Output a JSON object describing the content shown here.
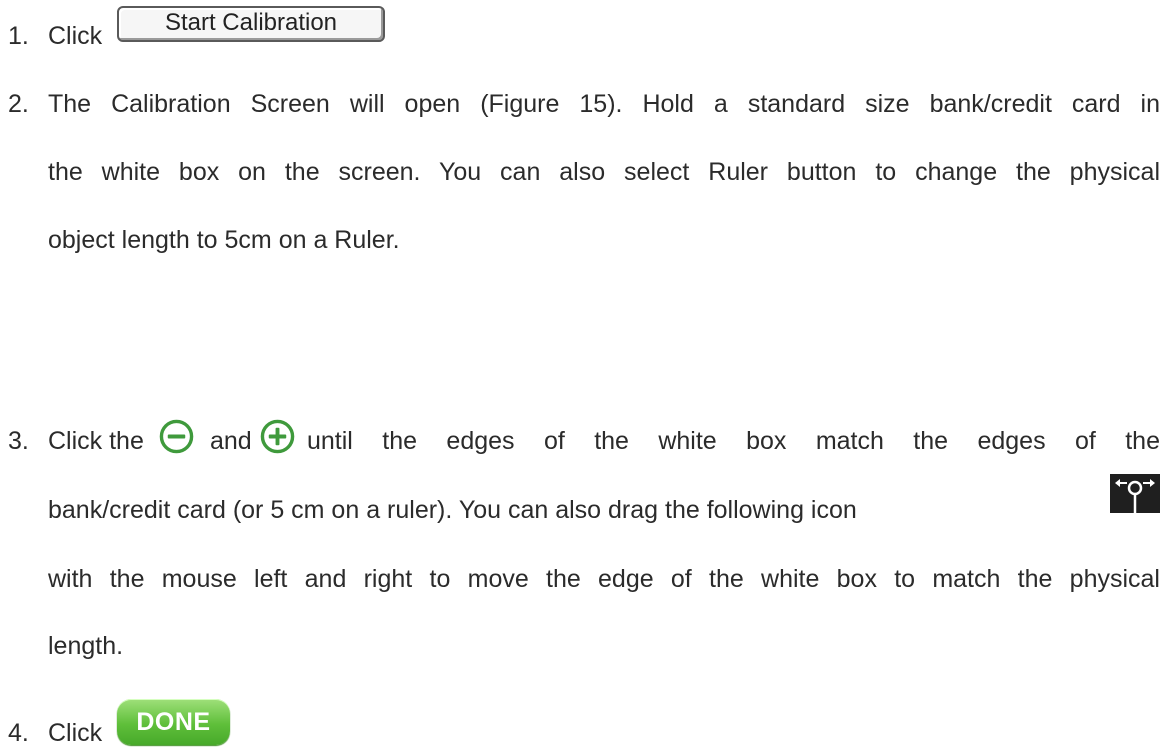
{
  "steps": [
    {
      "number": "1.",
      "prefix": "Click",
      "button_label": "Start Calibration"
    },
    {
      "number": "2.",
      "lines": [
        "The Calibration Screen will open (Figure 15). Hold a standard size bank/credit card in",
        "the white box on the screen.  You can also select Ruler button to change the physical",
        "object length to 5cm on a Ruler."
      ]
    },
    {
      "number": "3.",
      "line1_prefix": "Click the",
      "line1_mid": "and",
      "line1_suffix": "until the edges of the white box match the edges of the",
      "line2": "bank/credit card (or  5 cm on a ruler).  You can also drag the following icon",
      "line3": "with the mouse left and right to move the edge of the white box to match the physical",
      "line4": "length."
    },
    {
      "number": "4.",
      "prefix": "Click",
      "button_label": "DONE"
    }
  ],
  "icons": {
    "minus": "minus-circle-icon",
    "plus": "plus-circle-icon",
    "move": "move-edge-icon"
  },
  "colors": {
    "icon_green": "#3f9a3c",
    "done_green": "#5fbf3a",
    "text": "#2b2b2b"
  }
}
